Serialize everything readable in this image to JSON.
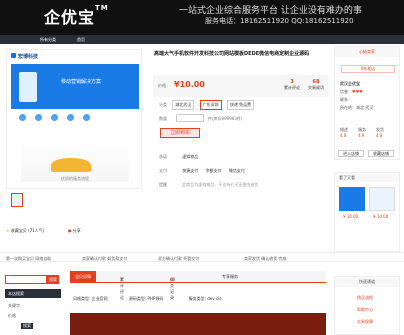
{
  "header": {
    "logo": "企优宝",
    "logo_tm": "TM",
    "slogan": "一站式企业综合服务平台 让企业没有难办的事",
    "contact": "服务电话：18162511920  QQ:18162511920"
  },
  "nav": {
    "all_categories": "所有分类",
    "home": "首页"
  },
  "product": {
    "image_brand": "宏博科技",
    "banner_text": "移动营销解决方案",
    "image_caption": "优质的服务流程",
    "title": "高端大气手机软件开发科技公司网站模板DEDE微信电商定制企业源码",
    "price_label": "价格",
    "price": "¥10.00",
    "stat1_value": "3",
    "stat1_label": "累计评论",
    "stat2_value": "68",
    "stat2_label": "交易成功",
    "option_label": "分类",
    "options": [
      "湖北武汉",
      "广东深圳",
      "快递 免运费"
    ],
    "quantity_label": "数量",
    "stock_text": "件(库存999903件)",
    "buy_button": "立即购买",
    "promise_label": "承诺",
    "promise_value": "虚拟物品",
    "pay_label": "支付",
    "pay_methods": [
      "快捷支付",
      "余额支付",
      "微信支付"
    ],
    "note_label": "提醒",
    "note_value": "此商品为虚拟物品，不支持七天无理由退货",
    "collect": "收藏宝贝 (71人气)",
    "share": "分享"
  },
  "seller": {
    "header": "心级卖家",
    "promise_badge": "0年老店",
    "shop_label": "武汉企优宝",
    "grade": "信誉：",
    "contact_label": "联系：",
    "address_label": "所在地：",
    "address": "湖北 武汉",
    "scores": [
      {
        "label": "描述",
        "value": "4.8"
      },
      {
        "label": "服务",
        "value": "4.9"
      },
      {
        "label": "发货",
        "value": "4.8"
      }
    ],
    "enter_shop": "进入店铺",
    "collect_shop": "收藏店铺"
  },
  "recommend": {
    "header": "看了又看",
    "items": [
      {
        "price": "¥ 10.00"
      },
      {
        "price": "¥ 10.00"
      }
    ]
  },
  "services": [
    "第一次购买宝贝 网络自助",
    "卖家确认付款 如货款支付",
    "双方确认付款 托管交付",
    "卖家发货 确认收货 完成"
  ],
  "tabs": [
    "宝贝详情",
    "累计评论",
    "成交记录",
    "专享服务"
  ],
  "tab_counts": [
    "3",
    "68"
  ],
  "left": {
    "search_placeholder": "",
    "search_button": "搜索",
    "header": "本店搜索",
    "keyword_label": "关键字",
    "price_label": "价格",
    "submit": "搜索"
  },
  "attributes": {
    "style": "风格类型: 企业官网",
    "lang": "源码类型: PHP源码",
    "service": "服务类型: dev cie"
  },
  "right_bottom": {
    "header": "快速通道",
    "items": [
      "购买流程",
      "帮助中心",
      "交易保障"
    ]
  }
}
